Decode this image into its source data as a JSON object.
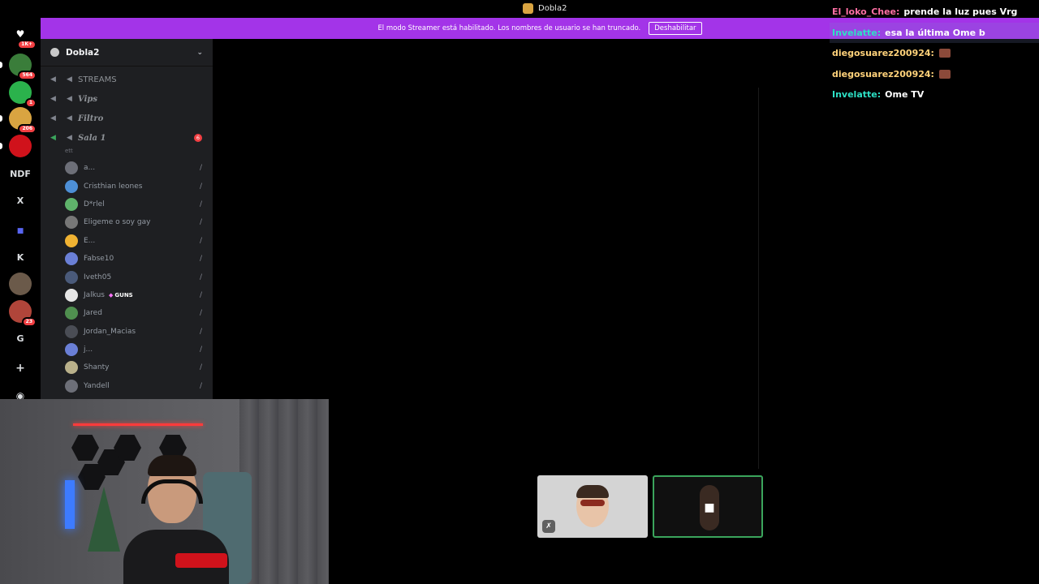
{
  "window": {
    "title": "Dobla2"
  },
  "banner": {
    "message": "El modo Streamer está habilitado. Los nombres de usuario se han truncado.",
    "button": "Deshabilitar"
  },
  "servers": [
    {
      "label": "",
      "color": "#5865f2",
      "icon": "discord-icon",
      "badge": "1K+"
    },
    {
      "label": "",
      "color": "#3a7d3a",
      "icon": "server-icon",
      "badge": "564"
    },
    {
      "label": "",
      "color": "#2bb24c",
      "icon": "server-icon",
      "badge": "1"
    },
    {
      "label": "",
      "color": "#d9a441",
      "icon": "server-icon",
      "badge": "206"
    },
    {
      "label": "",
      "color": "#d0121b",
      "icon": "spider-icon",
      "badge": ""
    },
    {
      "label": "NDF",
      "color": "",
      "icon": "",
      "badge": ""
    },
    {
      "label": "X",
      "color": "",
      "icon": "",
      "badge": ""
    },
    {
      "label": "",
      "color": "",
      "icon": "folder-icon",
      "badge": ""
    },
    {
      "label": "K",
      "color": "",
      "icon": "",
      "badge": ""
    },
    {
      "label": "",
      "color": "#6b5a4a",
      "icon": "server-icon",
      "badge": ""
    },
    {
      "label": "",
      "color": "#b0453a",
      "icon": "server-icon",
      "badge": "23"
    },
    {
      "label": "G",
      "color": "",
      "icon": "",
      "badge": ""
    },
    {
      "label": "",
      "color": "",
      "icon": "add-server-icon",
      "badge": ""
    },
    {
      "label": "",
      "color": "",
      "icon": "explore-icon",
      "badge": ""
    }
  ],
  "guild": {
    "name": "Dobla2"
  },
  "channels": [
    {
      "name": "STREAMS",
      "style": "plain",
      "count": ""
    },
    {
      "name": "Vips",
      "style": "italic",
      "count": ""
    },
    {
      "name": "Filtro",
      "style": "italic",
      "count": ""
    },
    {
      "name": "Sala 1",
      "style": "italic",
      "count": "6"
    }
  ],
  "active_sub": "ett",
  "members": [
    {
      "name": "a...",
      "color": "#6d6f78",
      "tag": ""
    },
    {
      "name": "Cristhian leones",
      "color": "#4d8fd6",
      "tag": ""
    },
    {
      "name": "D*rlel",
      "color": "#5fb36b",
      "tag": ""
    },
    {
      "name": "Eligeme o soy gay",
      "color": "#777",
      "tag": ""
    },
    {
      "name": "E...",
      "color": "#f0b232",
      "tag": ""
    },
    {
      "name": "Fabse10",
      "color": "#6a7fd6",
      "tag": ""
    },
    {
      "name": "Iveth05",
      "color": "#4a5a7a",
      "tag": ""
    },
    {
      "name": "Jalkus",
      "color": "#e6e6e6",
      "tag": "GUNS"
    },
    {
      "name": "Jared",
      "color": "#4f8f4f",
      "tag": ""
    },
    {
      "name": "Jordan_Macias",
      "color": "#4a4d55",
      "tag": ""
    },
    {
      "name": "j...",
      "color": "#6a7fd6",
      "tag": ""
    },
    {
      "name": "Shanty",
      "color": "#b9b08a",
      "tag": ""
    },
    {
      "name": "Yandell",
      "color": "#6d6f78",
      "tag": ""
    }
  ],
  "chat": [
    {
      "user": "El_loko_Chee:",
      "color": "#ff6fa3",
      "text": "prende la luz pues Vrg",
      "emote": false,
      "highlight": false
    },
    {
      "user": "Invelatte:",
      "color": "#2de0c5",
      "text": "esa la última Ome b",
      "emote": false,
      "highlight": true
    },
    {
      "user": "diegosuarez200924:",
      "color": "#ffd27a",
      "text": "",
      "emote": true,
      "highlight": false
    },
    {
      "user": "diegosuarez200924:",
      "color": "#ffd27a",
      "text": "",
      "emote": true,
      "highlight": false
    },
    {
      "user": "Invelatte:",
      "color": "#2de0c5",
      "text": "Ome TV",
      "emote": false,
      "highlight": false
    }
  ],
  "colors": {
    "banner": "#a334e8",
    "speaking": "#3ba55c",
    "channel_bg": "#1e1f22"
  }
}
